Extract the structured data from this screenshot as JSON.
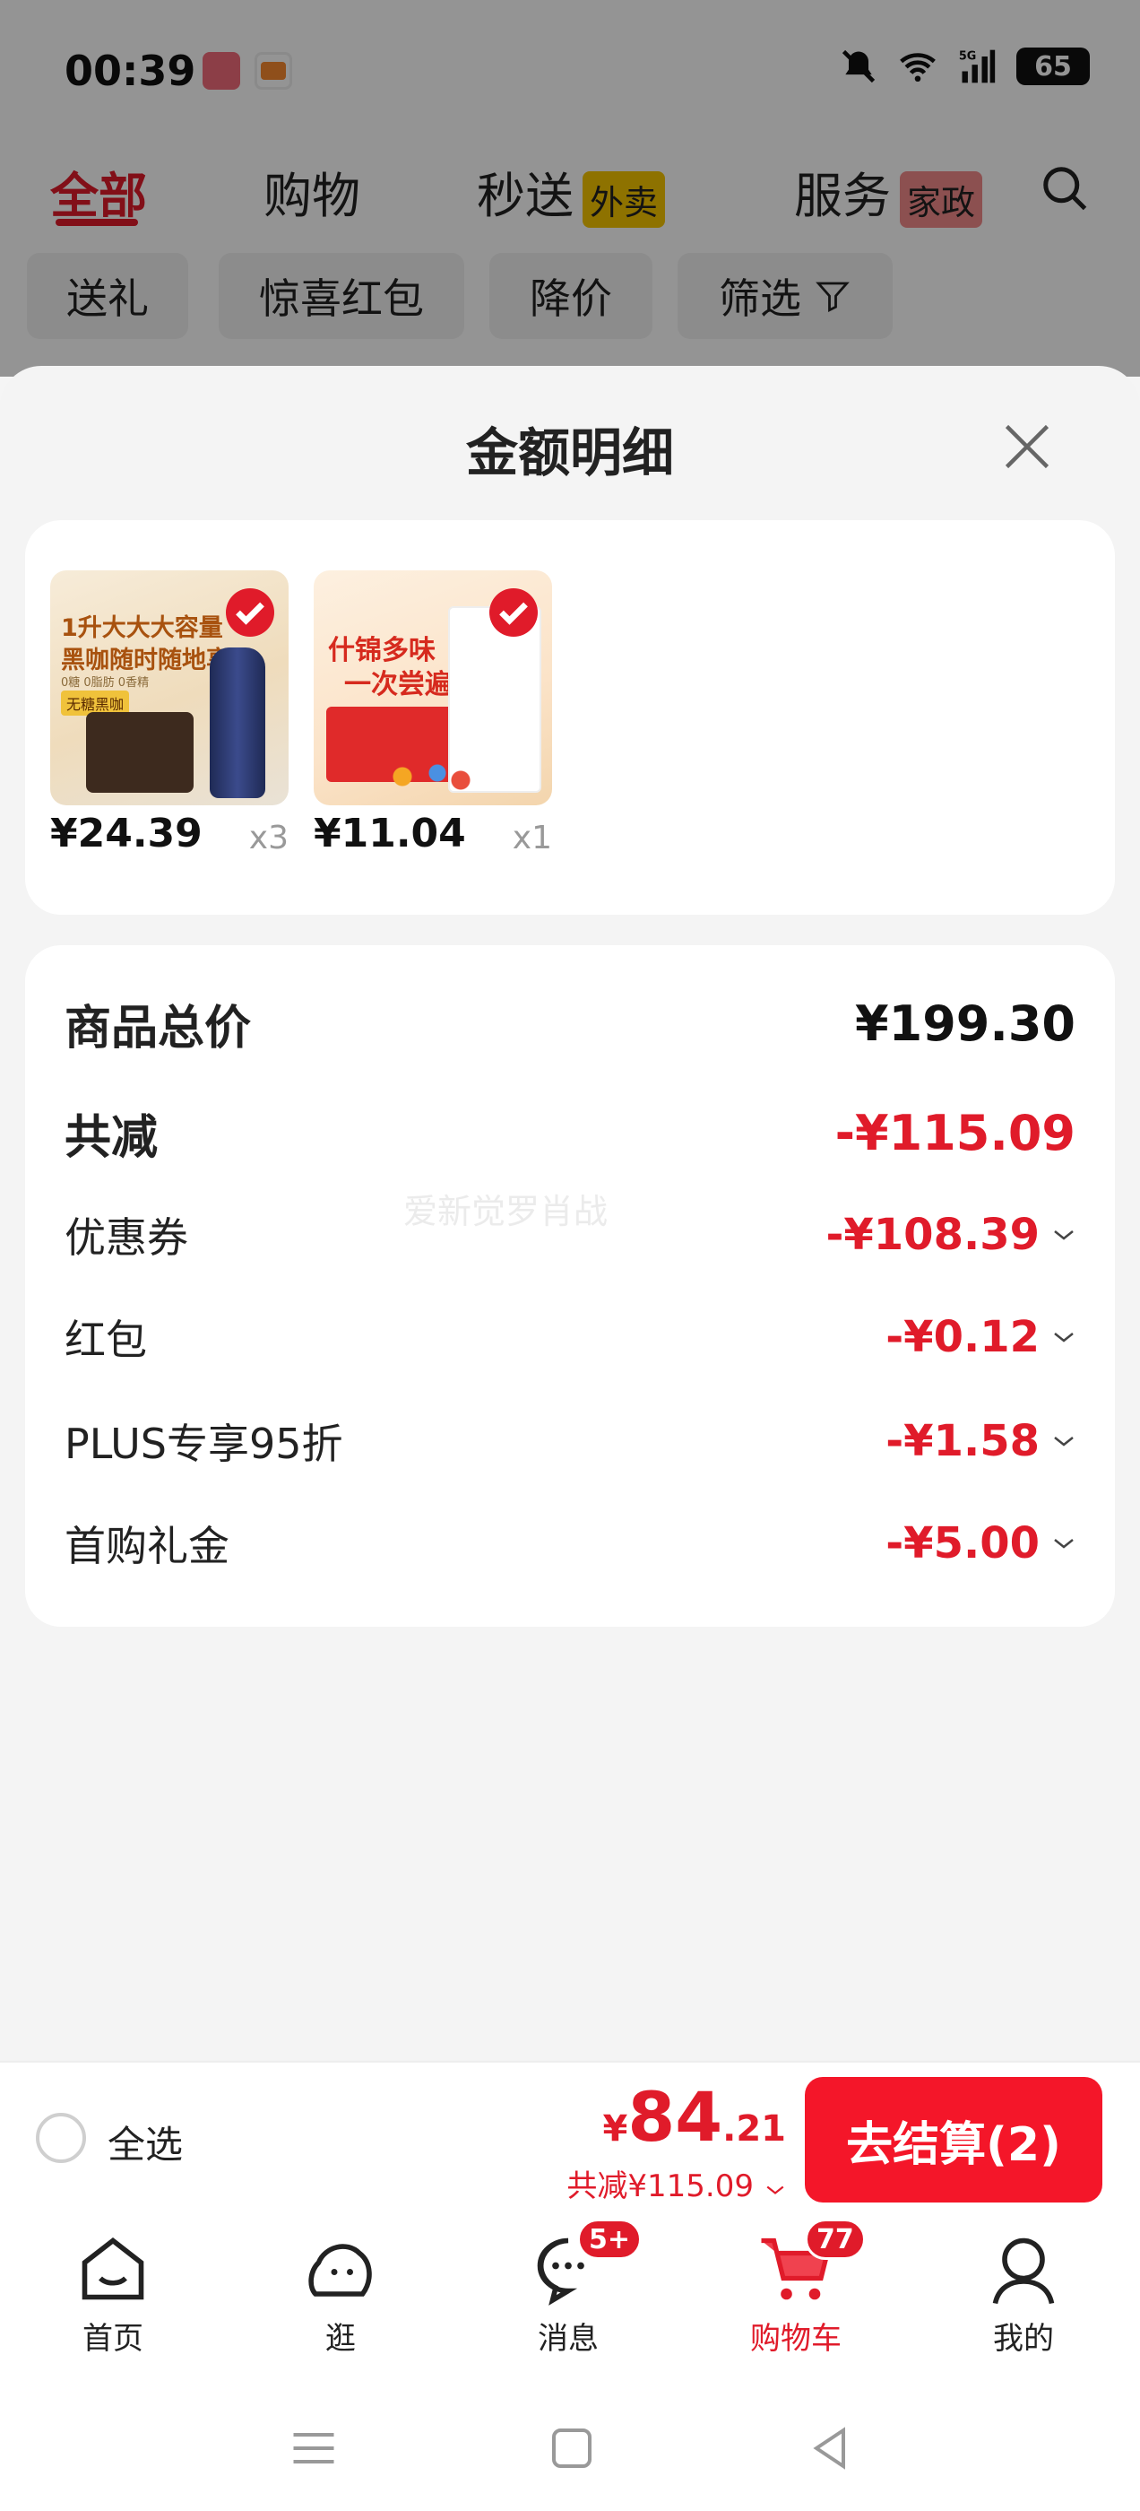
{
  "status_bar": {
    "time": "00:39",
    "signal_label": "5G",
    "battery": "65"
  },
  "top_tabs": [
    {
      "label": "全部"
    },
    {
      "label": "购物"
    },
    {
      "label": "秒送",
      "badge": "外卖",
      "badge_color": "#f5c400"
    },
    {
      "label": "服务",
      "badge": "家政",
      "badge_color": "#f28b8b"
    }
  ],
  "filters": [
    "送礼",
    "惊喜红包",
    "降价",
    "筛选"
  ],
  "sheet": {
    "title": "金额明细",
    "items": [
      {
        "price": "¥24.39",
        "qty": "x3",
        "image_text_1": "1升大大大容量",
        "image_text_2": "黑咖随时随地享",
        "image_text_3": "0糖 0脂肪 0香精",
        "image_tag": "无糖黑咖"
      },
      {
        "price": "¥11.04",
        "qty": "x1",
        "image_text_1": "什锦多味",
        "image_text_2": "一次尝遍"
      }
    ],
    "breakdown": {
      "total_label": "商品总价",
      "total_value": "¥199.30",
      "reduce_label": "共减",
      "reduce_value": "-¥115.09",
      "rows": [
        {
          "label": "优惠券",
          "value": "-¥108.39"
        },
        {
          "label": "红包",
          "value": "-¥0.12"
        },
        {
          "label": "PLUS专享95折",
          "value": "-¥1.58"
        },
        {
          "label": "首购礼金",
          "value": "-¥5.00"
        }
      ]
    },
    "watermark": "爱新觉罗肖战"
  },
  "checkout": {
    "select_all": "全选",
    "currency": "¥",
    "amount_int": "84",
    "amount_dec": ".21",
    "saved": "共减¥115.09",
    "button": "去结算(2)"
  },
  "bottom_nav": [
    {
      "label": "首页",
      "icon": "home-icon"
    },
    {
      "label": "逛",
      "icon": "browse-icon"
    },
    {
      "label": "消息",
      "icon": "message-icon",
      "badge": "5+"
    },
    {
      "label": "购物车",
      "icon": "cart-icon",
      "badge": "77",
      "active": true
    },
    {
      "label": "我的",
      "icon": "profile-icon"
    }
  ],
  "colors": {
    "accent": "#e01b2a",
    "button": "#f41629"
  }
}
